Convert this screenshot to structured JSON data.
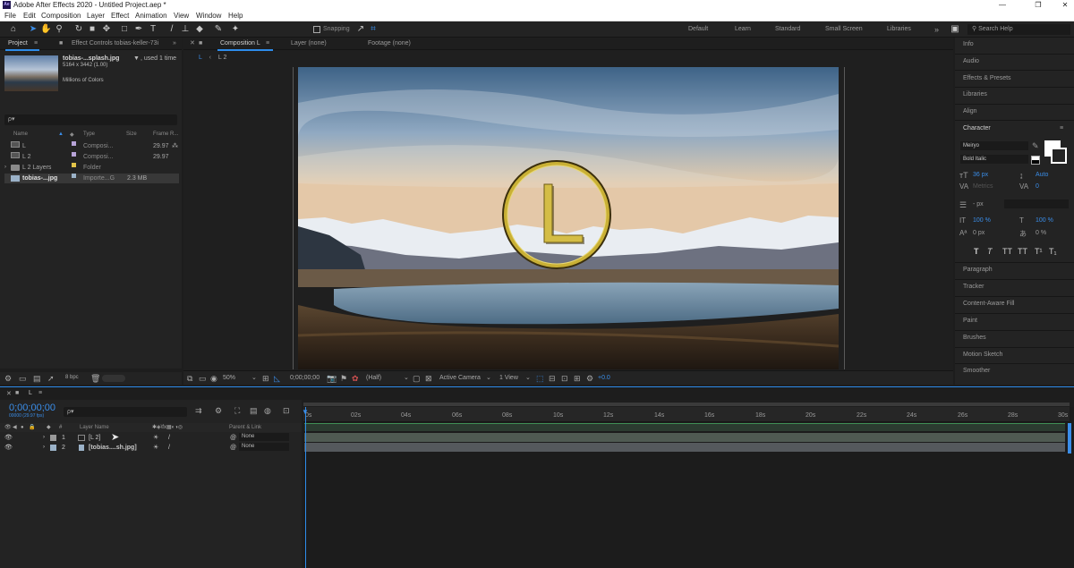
{
  "window": {
    "title": "Adobe After Effects 2020 - Untitled Project.aep *",
    "logo": "Ae",
    "controls": [
      "—",
      "❐",
      "✕"
    ]
  },
  "menu": [
    "File",
    "Edit",
    "Composition",
    "Layer",
    "Effect",
    "Animation",
    "View",
    "Window",
    "Help"
  ],
  "toolbar": {
    "snapping_label": "Snapping",
    "workspaces": [
      "Default",
      "Learn",
      "Standard",
      "Small Screen",
      "Libraries"
    ],
    "overflow": "»",
    "search_placeholder": "Search Help"
  },
  "project_panel": {
    "tab_project": "Project",
    "tab_effect_controls": "Effect Controls tobias-keller-73i",
    "selected_name": "tobias-...splash.jpg",
    "usage": ", used 1 time",
    "dimensions": "5164 x 3442 (1.00)",
    "colors": "Millions of Colors",
    "search_placeholder": "ρ▾",
    "columns": {
      "name": "Name",
      "type": "Type",
      "size": "Size",
      "frame_rate": "Frame R..."
    },
    "items": [
      {
        "name": "L",
        "type": "Composi...",
        "size": "",
        "fps": "29.97"
      },
      {
        "name": "L 2",
        "type": "Composi...",
        "size": "",
        "fps": "29.97"
      },
      {
        "name": "L 2 Layers",
        "type": "Folder",
        "size": "",
        "fps": ""
      },
      {
        "name": "tobias-...jpg",
        "type": "Importe...G",
        "size": "2.3 MB",
        "fps": ""
      }
    ],
    "bpc": "8 bpc"
  },
  "composition_panel": {
    "tab_comp": "Composition L",
    "tab_layer": "Layer (none)",
    "tab_footage": "Footage (none)",
    "breadcrumb": [
      "L",
      "L 2"
    ],
    "logo_letter": "L",
    "footer": {
      "zoom": "50%",
      "timecode": "0;00;00;00",
      "resolution": "(Half)",
      "camera": "Active Camera",
      "views": "1 View",
      "exposure": "+0.0"
    }
  },
  "right_panels": {
    "top": [
      "Info",
      "Audio",
      "Effects & Presets",
      "Libraries",
      "Align"
    ],
    "character": {
      "title": "Character",
      "font": "Meiryo",
      "style": "Bold Italic",
      "size": "36 px",
      "leading": "Auto",
      "kerning": "Metrics",
      "tracking": "0",
      "stroke": "- px",
      "vscale": "100 %",
      "hscale": "100 %",
      "baseline": "0 px",
      "tsume": "0 %",
      "styles": [
        "T",
        "T",
        "TT",
        "TT",
        "T¹",
        "T₁"
      ]
    },
    "bottom": [
      "Paragraph",
      "Tracker",
      "Content-Aware Fill",
      "Paint",
      "Brushes",
      "Motion Sketch",
      "Smoother"
    ]
  },
  "timeline": {
    "comp_tab": "L",
    "timecode": "0;00;00;00",
    "timecode_sub": "00000 (29.97 fps)",
    "search_placeholder": "ρ▾",
    "col_layer_name": "Layer Name",
    "col_parent": "Parent & Link",
    "ticks": [
      "0s",
      "02s",
      "04s",
      "06s",
      "08s",
      "10s",
      "12s",
      "14s",
      "16s",
      "18s",
      "20s",
      "22s",
      "24s",
      "26s",
      "28s",
      "30s"
    ],
    "layers": [
      {
        "num": "1",
        "name": "[L 2]",
        "parent": "None"
      },
      {
        "num": "2",
        "name": "[tobias....sh.jpg]",
        "parent": "None"
      }
    ]
  },
  "colors": {
    "accent": "#2d8ceb",
    "brand": "#1f1450",
    "logo_gold": "#c9b035",
    "comp_track": "#4a6a55",
    "img_track": "#5a5a5a"
  }
}
